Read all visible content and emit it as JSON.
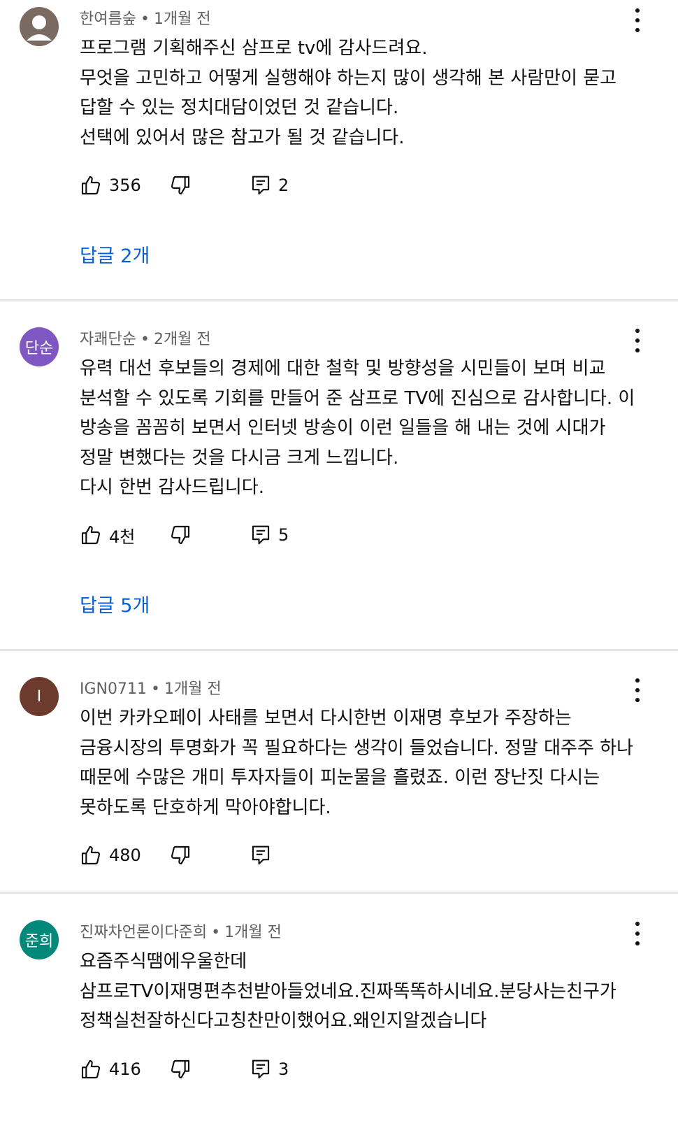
{
  "comments": [
    {
      "author": "한여름숲",
      "time": "1개월 전",
      "avatar": {
        "type": "default-person",
        "bg": "#7a6a62"
      },
      "lines": [
        "프로그램 기획해주신 삼프로 tv에 감사드려요.",
        "무엇을 고민하고 어떻게 실행해야 하는지 많이 생각해 본 사람만이 묻고",
        "답할 수 있는 정치대담이었던 것 같습니다.",
        "선택에 있어서 많은 참고가 될 것 같습니다."
      ],
      "likes": "356",
      "reply_count": "2",
      "replies_label": "답글 2개"
    },
    {
      "author": "자쾌단순",
      "time": "2개월 전",
      "avatar": {
        "type": "text",
        "label": "단순",
        "bg": "#7e57c2"
      },
      "lines": [
        "유력 대선 후보들의 경제에 대한 철학 및 방향성을 시민들이 보며 비교",
        "분석할 수 있도록 기회를 만들어 준 삼프로 TV에 진심으로 감사합니다. 이",
        "방송을 꼼꼼히 보면서 인터넷 방송이 이런 일들을 해 내는 것에 시대가",
        "정말 변했다는 것을 다시금 크게 느낍니다.",
        "다시 한번 감사드립니다."
      ],
      "likes": "4천",
      "reply_count": "5",
      "replies_label": "답글 5개"
    },
    {
      "author": "IGN0711",
      "time": "1개월 전",
      "avatar": {
        "type": "text",
        "label": "I",
        "bg": "#6d3b2e"
      },
      "lines": [
        "이번 카카오페이 사태를 보면서 다시한번 이재명 후보가 주장하는",
        "금융시장의 투명화가 꼭 필요하다는 생각이 들었습니다. 정말 대주주 하나",
        "때문에 수많은 개미 투자자들이 피눈물을 흘렸죠. 이런 장난짓 다시는",
        "못하도록 단호하게 막아야합니다."
      ],
      "likes": "480",
      "reply_count": "",
      "replies_label": ""
    },
    {
      "author": "진짜차언론이다준희",
      "time": "1개월 전",
      "avatar": {
        "type": "text",
        "label": "준희",
        "bg": "#00897b"
      },
      "lines": [
        "요즘주식땜에우울한데",
        "삼프로TV이재명편추천받아들었네요.진짜똑똑하시네요.분당사는친구가",
        "정책실천잘하신다고칭찬만이했어요.왜인지알겠습니다"
      ],
      "likes": "416",
      "reply_count": "3",
      "replies_label": ""
    }
  ]
}
